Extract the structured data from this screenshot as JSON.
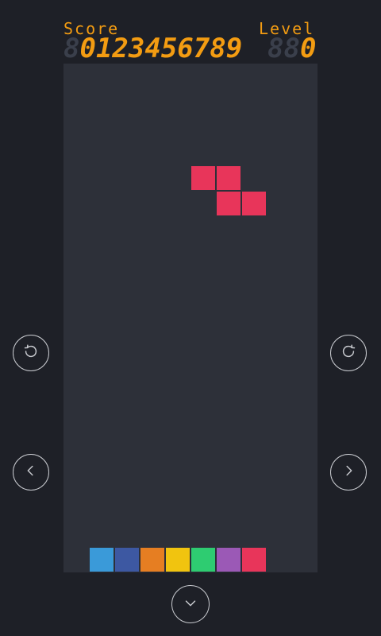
{
  "score": {
    "label": "Score",
    "ghost_digits": "8",
    "value": "0123456789"
  },
  "level": {
    "label": "Level",
    "ghost_digits": "88",
    "value": "0"
  },
  "colors": {
    "background": "#1e2027",
    "board": "#2d3039",
    "accent": "#f39c12",
    "ghost_digit": "#3a3f4b",
    "control_stroke": "#c9cbd0"
  },
  "falling_piece": {
    "shape": "Z",
    "color": "#e8355a"
  },
  "stack_row_colors": [
    "#3a9ad9",
    "#3d58a2",
    "#e67e22",
    "#f1c40f",
    "#2ecc71",
    "#9b59b6",
    "#e8355a"
  ],
  "controls": [
    {
      "name": "rotate-left-button",
      "icon": "rotate-ccw-icon"
    },
    {
      "name": "rotate-right-button",
      "icon": "rotate-cw-icon"
    },
    {
      "name": "move-left-button",
      "icon": "chevron-left-icon"
    },
    {
      "name": "move-right-button",
      "icon": "chevron-right-icon"
    },
    {
      "name": "drop-button",
      "icon": "chevron-down-icon"
    }
  ]
}
